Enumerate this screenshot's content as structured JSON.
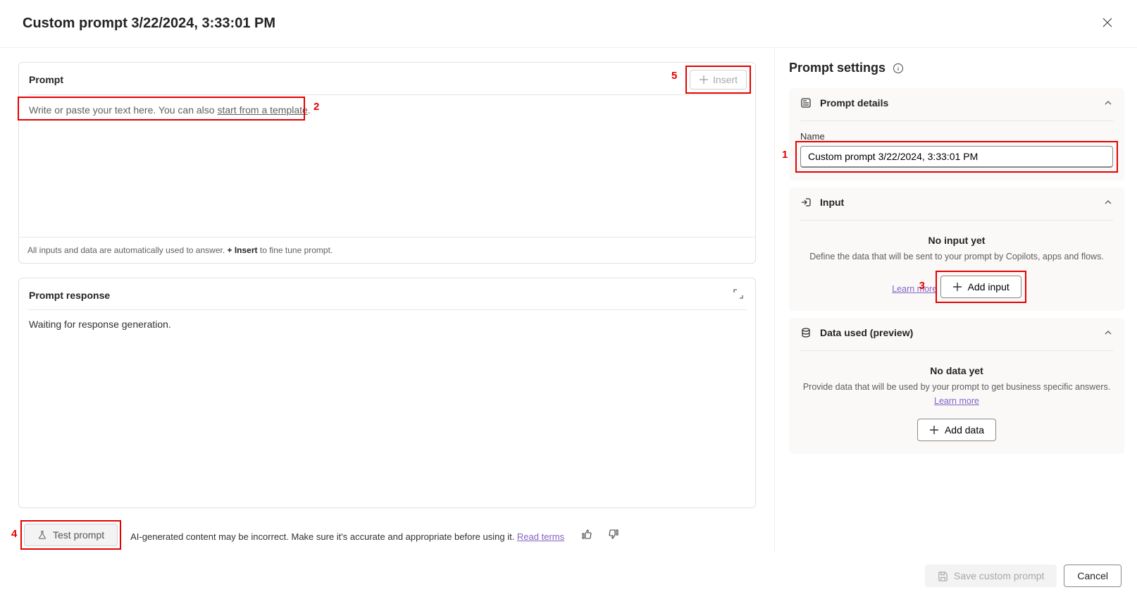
{
  "header": {
    "title": "Custom prompt 3/22/2024, 3:33:01 PM"
  },
  "prompt_panel": {
    "title": "Prompt",
    "insert_label": "Insert",
    "placeholder_prefix": "Write or paste your text here. You can also ",
    "placeholder_link": "start from a template",
    "placeholder_suffix": ".",
    "hint_prefix": "All inputs and data are automatically used to answer. ",
    "hint_bold": "+ Insert",
    "hint_suffix": " to fine tune prompt."
  },
  "response_panel": {
    "title": "Prompt response",
    "waiting_text": "Waiting for response generation."
  },
  "actions": {
    "test_label": "Test prompt",
    "disclaimer_text": "AI-generated content may be incorrect. Make sure it's accurate and appropriate before using it. ",
    "read_terms": "Read terms"
  },
  "sidebar": {
    "title": "Prompt settings",
    "details": {
      "title": "Prompt details",
      "name_label": "Name",
      "name_value": "Custom prompt 3/22/2024, 3:33:01 PM"
    },
    "input": {
      "title": "Input",
      "empty_title": "No input yet",
      "empty_desc": "Define the data that will be sent to your prompt by Copilots, apps and flows.",
      "learn_more": "Learn more",
      "add_label": "Add input"
    },
    "data": {
      "title": "Data used (preview)",
      "empty_title": "No data yet",
      "empty_desc": "Provide data that will be used by your prompt to get business specific answers.",
      "learn_more": "Learn more",
      "add_label": "Add data"
    }
  },
  "footer": {
    "save_label": "Save custom prompt",
    "cancel_label": "Cancel"
  },
  "annotations": {
    "n1": "1",
    "n2": "2",
    "n3": "3",
    "n4": "4",
    "n5": "5"
  }
}
